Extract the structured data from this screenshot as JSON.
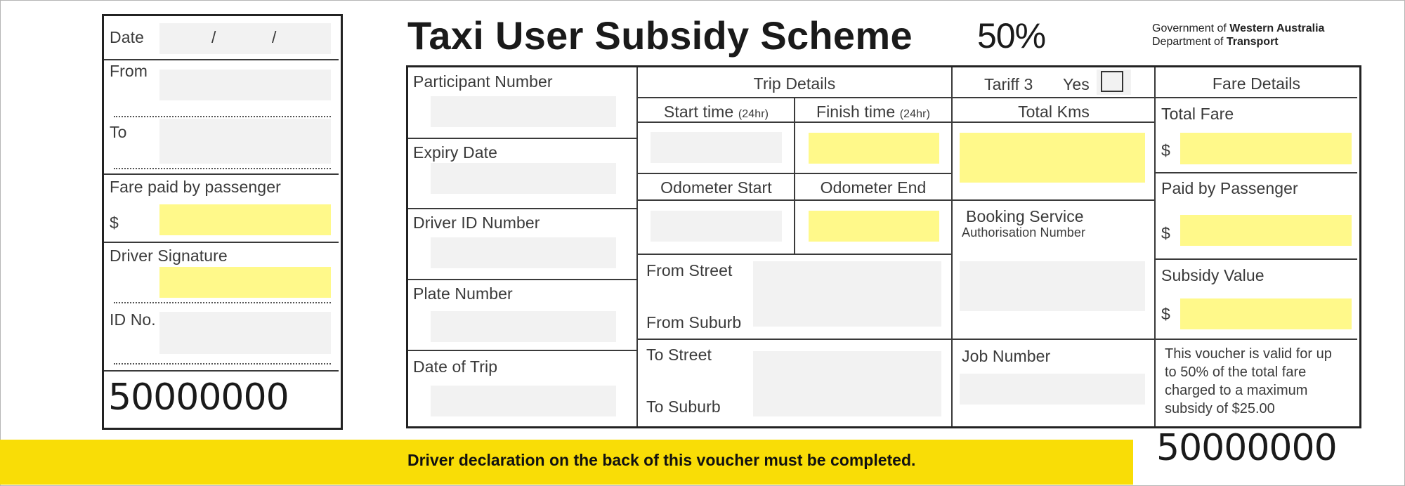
{
  "header": {
    "title": "Taxi User Subsidy Scheme",
    "percentage": "50%",
    "government_prefix": "Government of ",
    "government_name": "Western Australia",
    "department_prefix": "Department of ",
    "department_name": "Transport"
  },
  "stub": {
    "date_label": "Date",
    "date_separator_1": "/",
    "date_separator_2": "/",
    "from_label": "From",
    "to_label": "To",
    "fare_paid_label": "Fare paid by passenger",
    "currency_symbol": "$",
    "driver_signature_label": "Driver Signature",
    "id_no_label": "ID No.",
    "serial_number": "50000000"
  },
  "participant": {
    "participant_number_label": "Participant Number",
    "expiry_date_label": "Expiry Date",
    "driver_id_label": "Driver ID Number",
    "plate_number_label": "Plate Number",
    "date_of_trip_label": "Date of Trip"
  },
  "trip": {
    "heading": "Trip Details",
    "start_time_label": "Start time",
    "finish_time_label": "Finish time",
    "time_format_note": "(24hr)",
    "odometer_start_label": "Odometer Start",
    "odometer_end_label": "Odometer End",
    "from_street_label": "From Street",
    "from_suburb_label": "From Suburb",
    "to_street_label": "To Street",
    "to_suburb_label": "To Suburb"
  },
  "tariff": {
    "tariff_label": "Tariff 3",
    "yes_label": "Yes",
    "checked": false,
    "total_kms_label": "Total Kms",
    "booking_service_label": "Booking Service",
    "authorisation_number_label": "Authorisation Number",
    "job_number_label": "Job Number"
  },
  "fare": {
    "heading": "Fare Details",
    "total_fare_label": "Total Fare",
    "paid_by_passenger_label": "Paid by Passenger",
    "subsidy_value_label": "Subsidy Value",
    "currency_symbol": "$",
    "validity_note_lines": [
      "This voucher is valid for up",
      "to 50% of the total fare",
      "charged to a maximum",
      "subsidy of $25.00"
    ]
  },
  "footer": {
    "declaration_text": "Driver declaration on the back of this voucher must be completed.",
    "serial_number": "50000000"
  },
  "colors": {
    "input_grey": "#f2f2f2",
    "input_yellow": "#fff98a",
    "banner_yellow": "#f9dd06",
    "border": "#222222"
  }
}
